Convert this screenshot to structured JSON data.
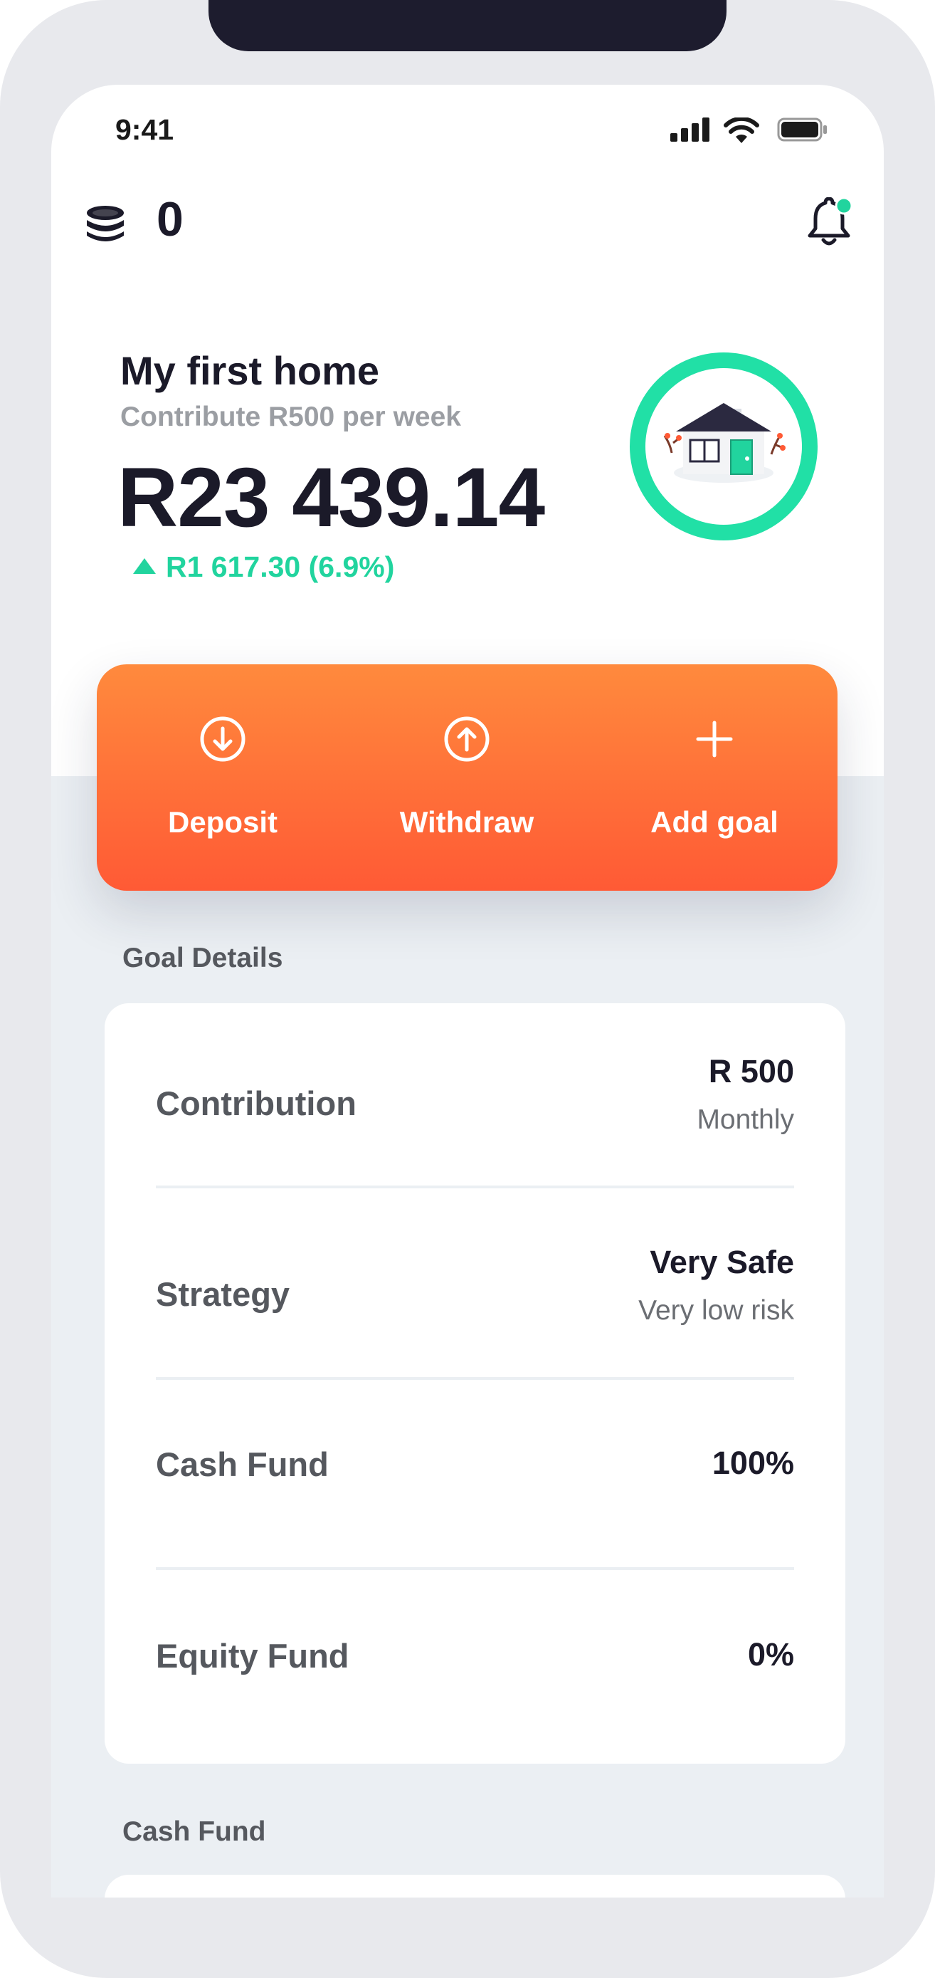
{
  "status_bar": {
    "time": "9:41"
  },
  "header": {
    "coin_count": "0",
    "has_notification": true
  },
  "goal": {
    "title": "My first home",
    "subtitle": "Contribute R500 per week",
    "amount": "R23 439.14",
    "change": "R1 617.30 (6.9%)",
    "icon": "house-icon"
  },
  "actions": [
    {
      "label": "Deposit",
      "icon": "arrow-down-circle-icon"
    },
    {
      "label": "Withdraw",
      "icon": "arrow-up-circle-icon"
    },
    {
      "label": "Add goal",
      "icon": "plus-icon"
    }
  ],
  "goal_details": {
    "section_title": "Goal Details",
    "rows": [
      {
        "label": "Contribution",
        "value": "R 500",
        "note": "Monthly"
      },
      {
        "label": "Strategy",
        "value": "Very Safe",
        "note": "Very low risk"
      },
      {
        "label": "Cash Fund",
        "value": "100%"
      },
      {
        "label": "Equity Fund",
        "value": "0%"
      }
    ]
  },
  "cash_fund": {
    "section_title": "Cash Fund"
  },
  "colors": {
    "accent_green": "#21d49e",
    "action_gradient_top": "#ff8a3d",
    "action_gradient_bottom": "#ff5a35",
    "text_dark": "#1b1a29",
    "background_light": "#ebeff3"
  }
}
